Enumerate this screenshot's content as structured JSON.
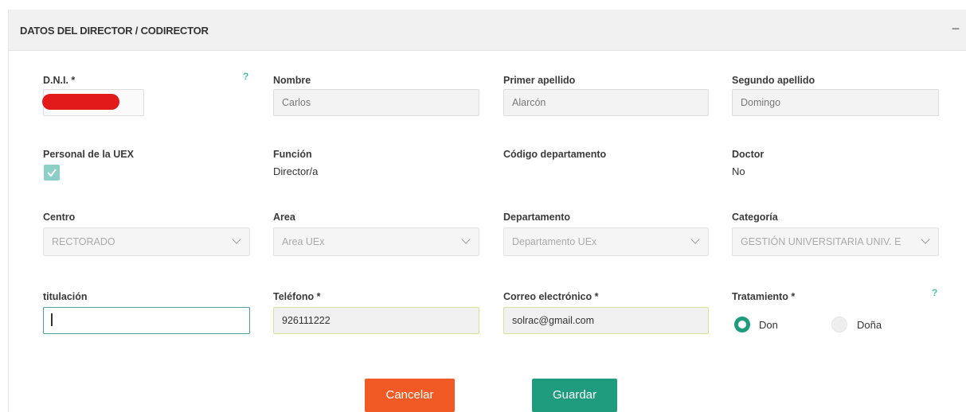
{
  "panel": {
    "title": "DATOS DEL DIRECTOR / CODIRECTOR",
    "collapse_symbol": "−"
  },
  "row1": {
    "dni": {
      "label": "D.N.I. *",
      "value": "",
      "redacted": true,
      "help": "?"
    },
    "nombre": {
      "label": "Nombre",
      "value": "Carlos"
    },
    "primer_apellido": {
      "label": "Primer apellido",
      "value": "Alarcón"
    },
    "segundo_apellido": {
      "label": "Segundo apellido",
      "value": "Domingo"
    }
  },
  "row2": {
    "personal_uex": {
      "label": "Personal de la UEX",
      "checked": true
    },
    "funcion": {
      "label": "Función",
      "value": "Director/a"
    },
    "codigo_departamento": {
      "label": "Código departamento",
      "value": ""
    },
    "doctor": {
      "label": "Doctor",
      "value": "No"
    }
  },
  "row3": {
    "centro": {
      "label": "Centro",
      "selected": "RECTORADO"
    },
    "area": {
      "label": "Area",
      "selected": "Area UEx"
    },
    "departamento": {
      "label": "Departamento",
      "selected": "Departamento UEx"
    },
    "categoria": {
      "label": "Categoría",
      "selected": "GESTIÓN UNIVERSITARIA UNIV. E"
    }
  },
  "row4": {
    "titulacion": {
      "label": "titulación",
      "value": ""
    },
    "telefono": {
      "label": "Teléfono *",
      "value": "926111222"
    },
    "correo": {
      "label": "Correo electrónico *",
      "value": "solrac@gmail.com"
    },
    "tratamiento": {
      "label": "Tratamiento *",
      "help": "?",
      "options": [
        "Don",
        "Doña"
      ],
      "selected": "Don"
    }
  },
  "buttons": {
    "cancel": "Cancelar",
    "save": "Guardar"
  },
  "colors": {
    "cancel": "#f15a24",
    "save": "#1f9b7e",
    "accent": "#4dbfb1",
    "redaction": "#e31a1a"
  },
  "icons": {
    "checkbox": "checkmark-icon",
    "select": "chevron-down-icon",
    "help": "question-mark-icon"
  }
}
